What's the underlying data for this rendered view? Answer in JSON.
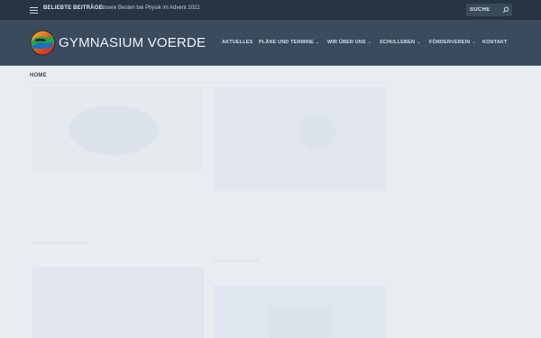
{
  "topbar": {
    "popular_label": "BELIEBTE BEITRÄGE:",
    "popular_post": "Unsere Besten bei Physik im Advent 2022",
    "search_placeholder": "SUCHE"
  },
  "header": {
    "site_title": "GYMNASIUM VOERDE"
  },
  "nav": {
    "items": [
      {
        "label": "AKTUELLES",
        "has_dropdown": false
      },
      {
        "label": "PLÄNE UND TERMINE",
        "has_dropdown": true
      },
      {
        "label": "WIR ÜBER UNS",
        "has_dropdown": true
      },
      {
        "label": "SCHULLEBEN",
        "has_dropdown": true
      },
      {
        "label": "FÖRDERVEREIN",
        "has_dropdown": true
      },
      {
        "label": "KONTAKT",
        "has_dropdown": false
      }
    ]
  },
  "breadcrumb": {
    "home": "HOME"
  },
  "icons": {
    "menu": "hamburger-menu-icon",
    "search": "search-icon",
    "logo": "school-logo",
    "dropdown": "chevron-down-icon"
  },
  "colors": {
    "topbar_bg": "#273443",
    "header_bg": "#3b4b5e",
    "page_bg": "#e9edf2"
  }
}
